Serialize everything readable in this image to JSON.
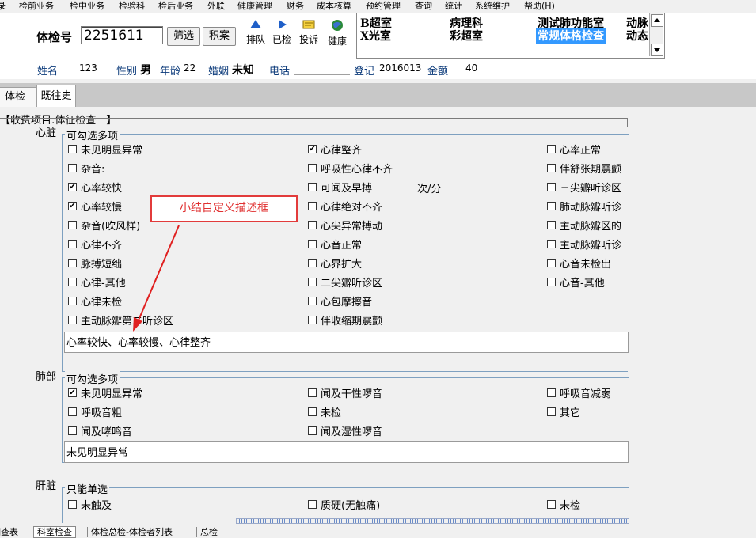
{
  "menu": [
    "录",
    "检前业务",
    "检中业务",
    "检验科",
    "检后业务",
    "外联",
    "健康管理",
    "财务",
    "成本核算",
    "预约管理",
    "查询",
    "统计",
    "系统维护",
    "帮助(H)"
  ],
  "header": {
    "exam_no_label": "体检号",
    "exam_no_value": "2251611",
    "filter_button": "筛选",
    "archive_button": "积案",
    "tools": [
      "排队",
      "已检",
      "投诉",
      "健康"
    ],
    "rooms_col1": [
      "B超室",
      "X光室"
    ],
    "rooms_col2": [
      "病理科",
      "彩超室"
    ],
    "rooms_col3": [
      "测试肺功能室",
      "常规体格检查"
    ],
    "rooms_col4": [
      "动脉",
      "动态"
    ]
  },
  "patient": {
    "name_label": "姓名",
    "name_value": "123",
    "sex_label": "性别",
    "sex_value": "男",
    "age_label": "年龄",
    "age_value": "22",
    "marriage_label": "婚姻",
    "marriage_value": "未知",
    "phone_label": "电话",
    "phone_value": "",
    "reg_label": "登记",
    "reg_value": "2016013",
    "amount_label": "金额",
    "amount_value": "40"
  },
  "tabs": [
    "体检",
    "既往史"
  ],
  "fee_item_title": "【收费项目:体征检查　】",
  "heart": {
    "label": "心脏",
    "legend": "可勾选多项",
    "col1": [
      {
        "text": "未见明显异常",
        "checked": false
      },
      {
        "text": "杂音:",
        "checked": false
      },
      {
        "text": "心率较快",
        "checked": true
      },
      {
        "text": "心率较慢",
        "checked": true
      },
      {
        "text": "杂音(吹风样)",
        "checked": false
      },
      {
        "text": "心律不齐",
        "checked": false
      },
      {
        "text": "脉搏短绌",
        "checked": false
      },
      {
        "text": "心律-其他",
        "checked": false
      },
      {
        "text": "心律未检",
        "checked": false
      },
      {
        "text": "主动脉瓣第二听诊区",
        "checked": false
      }
    ],
    "col2": [
      {
        "text": "心律整齐",
        "checked": true
      },
      {
        "text": "呼吸性心律不齐",
        "checked": false
      },
      {
        "text": "可闻及早搏",
        "checked": false
      },
      {
        "text": "心律绝对不齐",
        "checked": false
      },
      {
        "text": "心尖异常搏动",
        "checked": false
      },
      {
        "text": "心音正常",
        "checked": false
      },
      {
        "text": "心界扩大",
        "checked": false
      },
      {
        "text": "二尖瓣听诊区",
        "checked": false
      },
      {
        "text": "心包摩擦音",
        "checked": false
      },
      {
        "text": "伴收缩期震颤",
        "checked": false
      }
    ],
    "col3": [
      {
        "text": "心率正常",
        "checked": false
      },
      {
        "text": "伴舒张期震颤",
        "checked": false
      },
      {
        "text": "三尖瓣听诊区",
        "checked": false
      },
      {
        "text": "肺动脉瓣听诊",
        "checked": false
      },
      {
        "text": "主动脉瓣区的",
        "checked": false
      },
      {
        "text": "主动脉瓣听诊",
        "checked": false
      },
      {
        "text": "心音未检出",
        "checked": false
      },
      {
        "text": "心音-其他",
        "checked": false
      }
    ],
    "premature_unit": "次/分",
    "summary": "心率较快、心率较慢、心律整齐",
    "callout": "小结自定义描述框"
  },
  "lung": {
    "label": "肺部",
    "legend": "可勾选多项",
    "col1": [
      {
        "text": "未见明显异常",
        "checked": true
      },
      {
        "text": "呼吸音粗",
        "checked": false
      },
      {
        "text": "闻及哮鸣音",
        "checked": false
      }
    ],
    "col2": [
      {
        "text": "闻及干性啰音",
        "checked": false
      },
      {
        "text": "未检",
        "checked": false
      },
      {
        "text": "闻及湿性啰音",
        "checked": false
      }
    ],
    "col3": [
      {
        "text": "呼吸音减弱",
        "checked": false
      },
      {
        "text": "其它",
        "checked": false
      }
    ],
    "summary": "未见明显异常"
  },
  "liver": {
    "label": "肝脏",
    "legend": "只能单选",
    "col1": [
      {
        "text": "未触及",
        "checked": false
      }
    ],
    "col2": [
      {
        "text": "质硬(无触痛)",
        "checked": false
      }
    ],
    "col3": [
      {
        "text": "未检",
        "checked": false
      }
    ]
  },
  "bottom_tabs": [
    "调查表",
    "科室检查",
    "体检总检-体检者列表",
    "总检"
  ]
}
